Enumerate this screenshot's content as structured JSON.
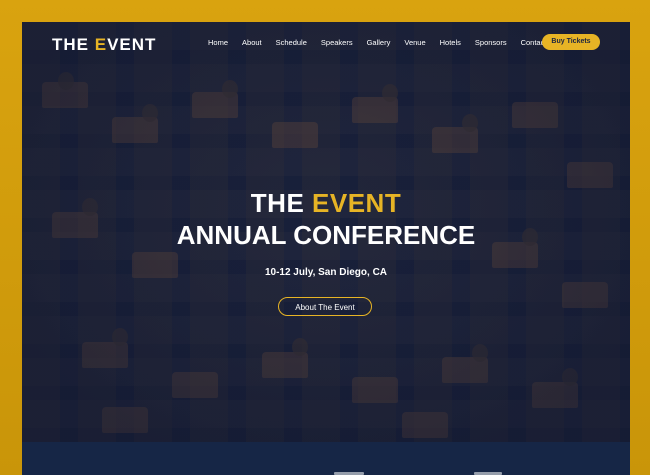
{
  "brand": {
    "logo_prefix": "THE ",
    "logo_accent": "E",
    "logo_suffix": "VENT",
    "accent_color": "#e7b425",
    "background_color": "#d9a30f"
  },
  "nav": {
    "items": [
      "Home",
      "About",
      "Schedule",
      "Speakers",
      "Gallery",
      "Venue",
      "Hotels",
      "Sponsors",
      "Contact"
    ],
    "buy_label": "Buy Tickets"
  },
  "hero": {
    "title_prefix": "THE ",
    "title_accent": "EVENT",
    "subtitle": "ANNUAL CONFERENCE",
    "date_location": "10-12 July, San Diego, CA",
    "cta_label": "About The Event"
  }
}
